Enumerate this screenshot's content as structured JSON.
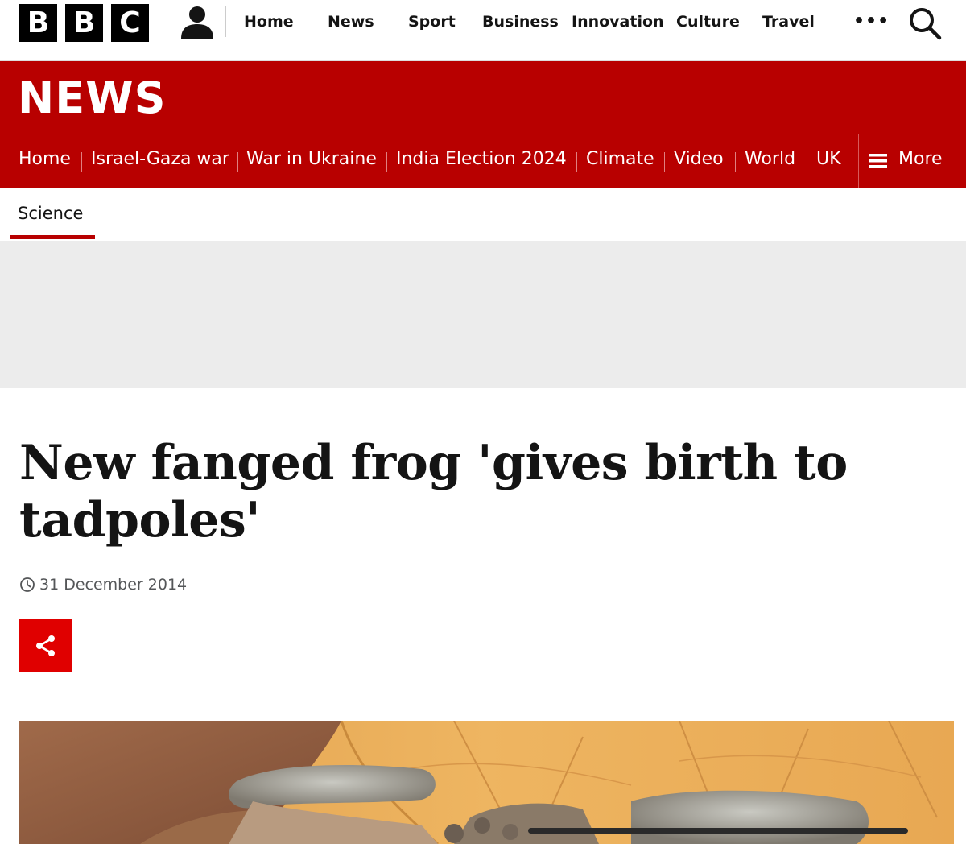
{
  "masthead": {
    "logo_letters": [
      "B",
      "B",
      "C"
    ],
    "account_icon": "user-icon",
    "nav": [
      "Home",
      "News",
      "Sport",
      "Business",
      "Innovation",
      "Culture",
      "Travel"
    ],
    "more_icon": "ellipsis-icon",
    "more_text": "•••",
    "search_icon": "search-icon"
  },
  "banner": {
    "title": "NEWS"
  },
  "section_nav": {
    "items": [
      "Home",
      "Israel-Gaza war",
      "War in Ukraine",
      "India Election 2024",
      "Climate",
      "Video",
      "World",
      "UK"
    ],
    "more_label": "More",
    "more_icon": "menu-icon"
  },
  "subnav": {
    "active": "Science"
  },
  "article": {
    "headline": "New fanged frog 'gives birth to tadpoles'",
    "date": "31 December 2014",
    "clock_icon": "clock-icon",
    "share_icon": "share-icon"
  },
  "colors": {
    "brand_red": "#b80000",
    "share_red": "#e00000",
    "ad_gray": "#ececec"
  }
}
